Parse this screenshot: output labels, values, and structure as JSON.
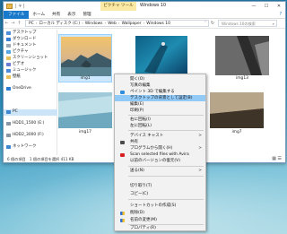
{
  "colors": {
    "accent": "#1979ca",
    "selection": "#cce8ff",
    "menu_highlight": "#91c9f7",
    "tools_tab": "#fce9a6"
  },
  "window": {
    "title": "Windows 10",
    "quick_access": "| ∓ |",
    "tools_tab": "ピクチャ ツール",
    "controls": [
      "—",
      "☐",
      "✕"
    ]
  },
  "ribbon": {
    "tabs": [
      "ファイル",
      "ホーム",
      "共有",
      "表示",
      "管理"
    ],
    "help": "?"
  },
  "address": {
    "back": "←",
    "forward": "→",
    "up": "↑",
    "segments": [
      "PC",
      "ローカル ディスク (C:)",
      "Windows",
      "Web",
      "Wallpaper",
      "Windows 10"
    ],
    "dropdown": "˅",
    "refresh": "↻",
    "search_placeholder": "Windows 10の検索"
  },
  "nav": {
    "items": [
      {
        "label": "デスクトップ",
        "icon": "desktop-icon",
        "color": "#4f8fd8"
      },
      {
        "label": "ダウンロード",
        "icon": "download-icon",
        "color": "#3a7ed6"
      },
      {
        "label": "ドキュメント",
        "icon": "documents-icon",
        "color": "#9aa7b6"
      },
      {
        "label": "ピクチャ",
        "icon": "pictures-icon",
        "color": "#58a6e0"
      },
      {
        "label": "スクリーンショット",
        "icon": "folder-icon",
        "color": "#e9c15a"
      },
      {
        "label": "ビデオ",
        "icon": "videos-icon",
        "color": "#6a7bd4"
      },
      {
        "label": "ミュージック",
        "icon": "music-icon",
        "color": "#4d8ad9"
      },
      {
        "label": "壁紙",
        "icon": "folder-icon",
        "color": "#e9c15a"
      },
      {
        "label": "OneDrive",
        "icon": "onedrive-icon",
        "color": "#2c7ad4"
      },
      {
        "label": "PC",
        "icon": "pc-icon",
        "color": "#3f86cf"
      },
      {
        "label": "HDD1_1500 (E:)",
        "icon": "drive-icon",
        "color": "#8896a6"
      },
      {
        "label": "HDD2_3000 (F:)",
        "icon": "drive-icon",
        "color": "#8896a6"
      },
      {
        "label": "ネットワーク",
        "icon": "network-icon",
        "color": "#3f86cf"
      }
    ]
  },
  "files": [
    {
      "label": "img1"
    },
    {
      "label": "img10"
    },
    {
      "label": "img13"
    },
    {
      "label": "img17"
    },
    {
      "label": "img4"
    },
    {
      "label": "img7"
    }
  ],
  "status": {
    "text": "6 個の項目　1 個の項目を選択  411 KB",
    "views": "▦ ☰"
  },
  "menu": {
    "items": [
      {
        "label": "開く(O)",
        "icon": ""
      },
      {
        "label": "写真の編集",
        "icon": ""
      },
      {
        "label": "ペイント 3D で編集する",
        "icon": "paint3d-icon"
      },
      {
        "label": "デスクトップの背景として設定(B)",
        "icon": "",
        "highlight": true
      },
      {
        "label": "編集(E)",
        "icon": ""
      },
      {
        "label": "印刷(P)",
        "icon": ""
      },
      {
        "label": "右に回転(I)",
        "icon": ""
      },
      {
        "label": "左に回転(L)",
        "icon": ""
      },
      {
        "label": "デバイス キャスト",
        "icon": "",
        "sub": true
      },
      {
        "label": "共有",
        "icon": "share-icon"
      },
      {
        "label": "プログラムから開く(H)",
        "icon": "",
        "sub": true
      },
      {
        "label": "Scan selected files with Avira",
        "icon": "avira-icon"
      },
      {
        "label": "以前のバージョンの復元(V)",
        "icon": ""
      },
      {
        "label": "送る(N)",
        "icon": "",
        "sub": true
      },
      {
        "label": "切り取り(T)",
        "icon": ""
      },
      {
        "label": "コピー(C)",
        "icon": ""
      },
      {
        "label": "ショートカットの作成(S)",
        "icon": ""
      },
      {
        "label": "削除(D)",
        "icon": "shield-icon"
      },
      {
        "label": "名前の変更(M)",
        "icon": "shield-icon"
      },
      {
        "label": "プロパティ(R)",
        "icon": ""
      }
    ],
    "submenu_arrow": ">"
  }
}
